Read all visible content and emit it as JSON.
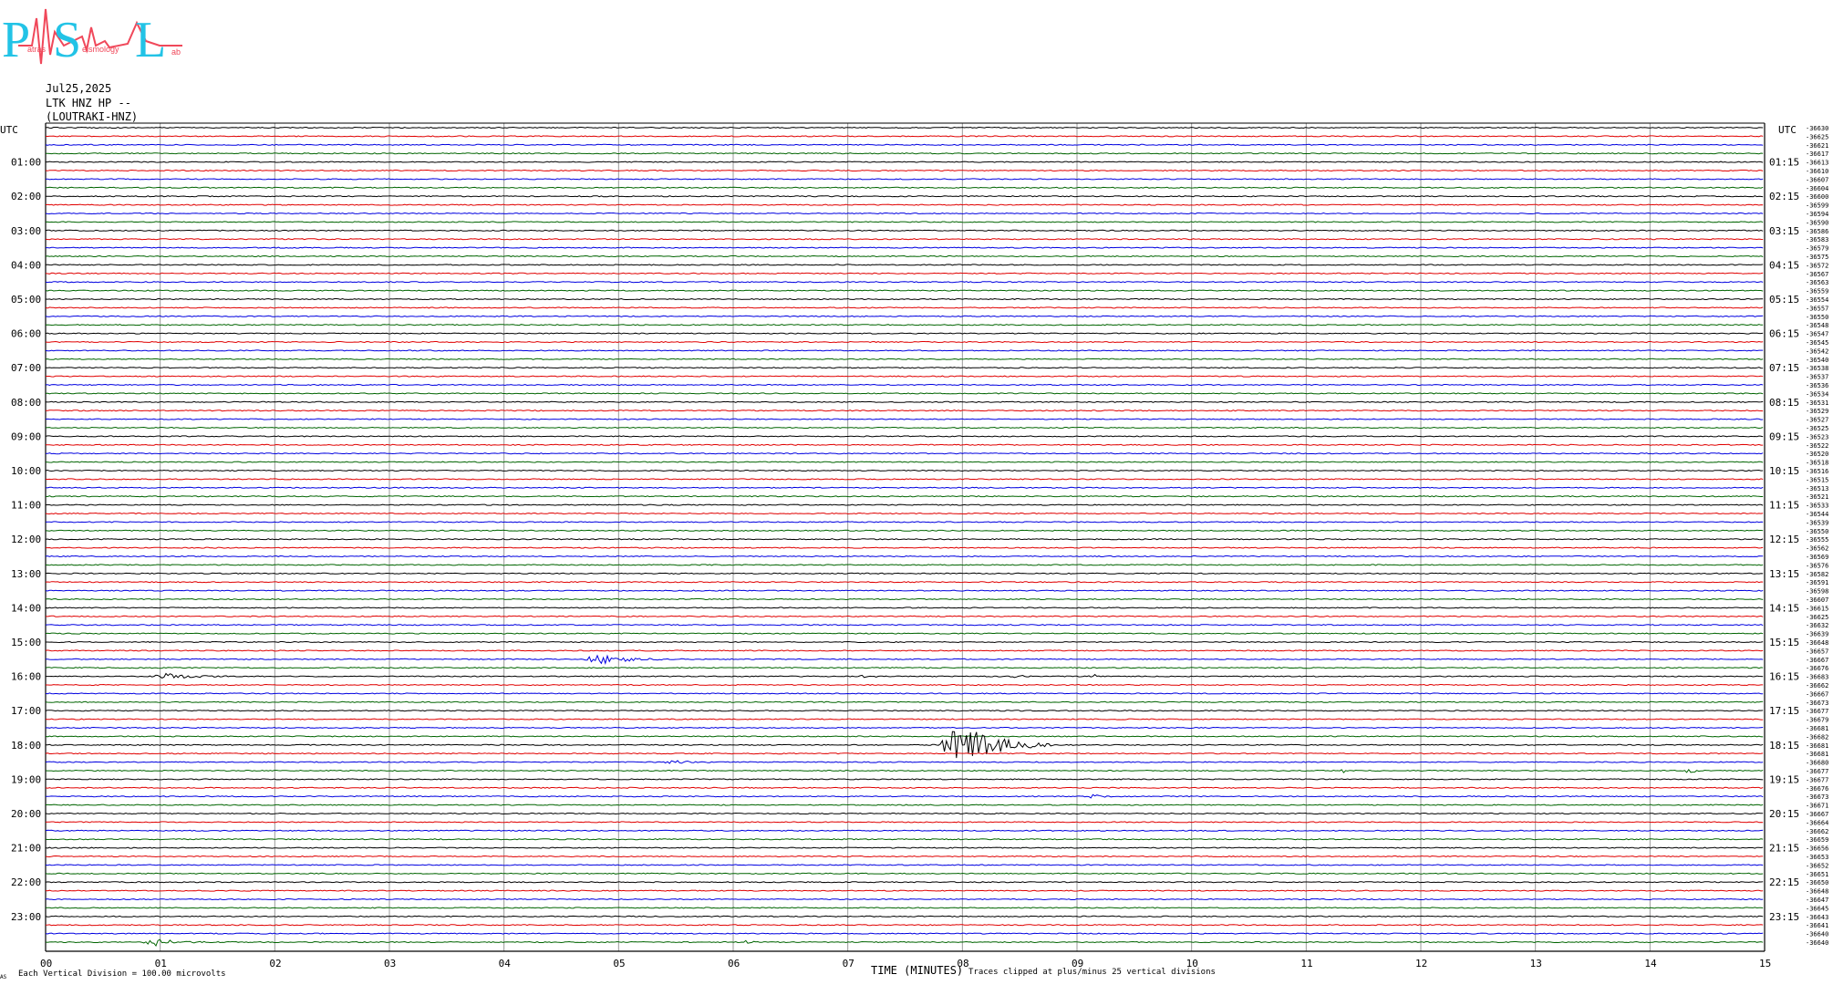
{
  "logo": {
    "letters": [
      "P",
      "S",
      "L"
    ],
    "subtext_fragments": [
      "atras",
      "eismology",
      "ab"
    ],
    "colors": {
      "letters": "#22c3e6",
      "wave": "#f0485a"
    }
  },
  "header": {
    "date": "Jul25,2025",
    "station": "LTK HNZ HP --",
    "location": "(LOUTRAKI-HNZ)"
  },
  "chart_data": {
    "type": "line",
    "plot_kind": "helicorder",
    "left_axis_title": "UTC",
    "right_axis_title": "UTC",
    "left_hour_labels": [
      "01:00",
      "02:00",
      "03:00",
      "04:00",
      "05:00",
      "06:00",
      "07:00",
      "08:00",
      "09:00",
      "10:00",
      "11:00",
      "12:00",
      "13:00",
      "14:00",
      "15:00",
      "16:00",
      "17:00",
      "18:00",
      "19:00",
      "20:00",
      "21:00",
      "22:00",
      "23:00"
    ],
    "right_hour_labels": [
      "01:15",
      "02:15",
      "03:15",
      "04:15",
      "05:15",
      "06:15",
      "07:15",
      "08:15",
      "09:15",
      "10:15",
      "11:15",
      "12:15",
      "13:15",
      "14:15",
      "15:15",
      "16:15",
      "17:15",
      "18:15",
      "19:15",
      "20:15",
      "21:15",
      "22:15",
      "23:15"
    ],
    "x_tick_labels": [
      "00",
      "01",
      "02",
      "03",
      "04",
      "05",
      "06",
      "07",
      "08",
      "09",
      "10",
      "11",
      "12",
      "13",
      "14",
      "15"
    ],
    "xlabel": "TIME (MINUTES)",
    "xlim": [
      0,
      15
    ],
    "trace_count": 96,
    "trace_minutes": 15,
    "trace_colors": [
      "#000000",
      "#e00000",
      "#0000e0",
      "#006400"
    ],
    "grid": "vertical lines each minute",
    "right_offsets": [
      -36630,
      -36625,
      -36621,
      -36617,
      -36613,
      -36610,
      -36607,
      -36604,
      -36600,
      -36599,
      -36594,
      -36590,
      -36586,
      -36583,
      -36579,
      -36575,
      -36572,
      -36567,
      -36563,
      -36559,
      -36554,
      -36557,
      -36550,
      -36548,
      -36547,
      -36545,
      -36542,
      -36540,
      -36538,
      -36537,
      -36536,
      -36534,
      -36531,
      -36529,
      -36527,
      -36525,
      -36523,
      -36522,
      -36520,
      -36518,
      -36516,
      -36515,
      -36513,
      -36521,
      -36533,
      -36544,
      -36539,
      -36550,
      -36555,
      -36562,
      -36569,
      -36576,
      -36582,
      -36591,
      -36598,
      -36607,
      -36615,
      -36625,
      -36632,
      -36639,
      -36648,
      -36657,
      -36667,
      -36676,
      -36683,
      -36662,
      -36667,
      -36673,
      -36677,
      -36679,
      -36681,
      -36682,
      -36681,
      -36681,
      -36680,
      -36677,
      -36677,
      -36676,
      -36673,
      -36671,
      -36667,
      -36664,
      -36662,
      -36659,
      -36656,
      -36653,
      -36652,
      -36651,
      -36650,
      -36648,
      -36647,
      -36645,
      -36643,
      -36641,
      -36640,
      -36640
    ],
    "events": [
      {
        "trace": 62,
        "start_min": 4.7,
        "end_min": 5.4,
        "amplitude": 0.65
      },
      {
        "trace": 64,
        "start_min": 0.9,
        "end_min": 1.6,
        "amplitude": 0.35
      },
      {
        "trace": 64,
        "start_min": 7.1,
        "end_min": 7.3,
        "amplitude": 0.3
      },
      {
        "trace": 64,
        "start_min": 8.4,
        "end_min": 8.6,
        "amplitude": 0.3
      },
      {
        "trace": 64,
        "start_min": 9.1,
        "end_min": 9.3,
        "amplitude": 0.3
      },
      {
        "trace": 72,
        "start_min": 7.8,
        "end_min": 8.8,
        "amplitude": 2.6
      },
      {
        "trace": 74,
        "start_min": 5.4,
        "end_min": 5.8,
        "amplitude": 0.3
      },
      {
        "trace": 75,
        "start_min": 11.3,
        "end_min": 11.4,
        "amplitude": 0.3
      },
      {
        "trace": 75,
        "start_min": 14.3,
        "end_min": 14.5,
        "amplitude": 0.3
      },
      {
        "trace": 78,
        "start_min": 9.1,
        "end_min": 9.3,
        "amplitude": 0.35
      },
      {
        "trace": 95,
        "start_min": 0.85,
        "end_min": 1.4,
        "amplitude": 0.45
      },
      {
        "trace": 95,
        "start_min": 6.1,
        "end_min": 6.2,
        "amplitude": 0.3
      }
    ]
  },
  "footer": {
    "left_note": "Each Vertical Division =  100.00 microvolts",
    "center_label": "TIME (MINUTES)",
    "right_note": "Traces clipped at plus/minus 25 vertical divisions",
    "corner_mark": "AS"
  }
}
